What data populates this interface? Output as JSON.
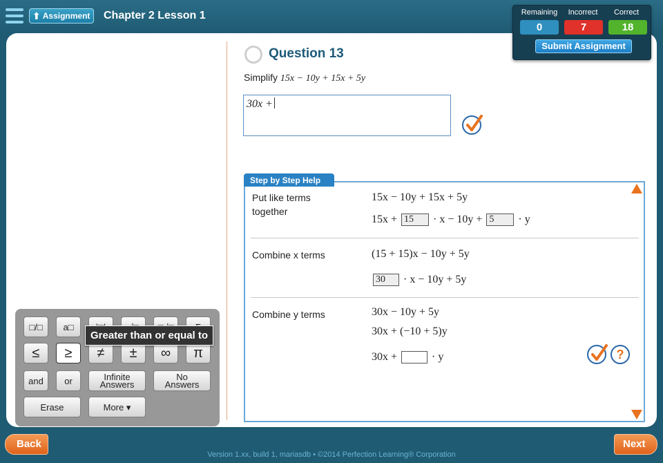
{
  "header": {
    "assignment_label": "Assignment",
    "chapter_title": "Chapter 2 Lesson 1"
  },
  "score": {
    "remaining_label": "Remaining",
    "remaining_value": "0",
    "incorrect_label": "Incorrect",
    "incorrect_value": "7",
    "correct_label": "Correct",
    "correct_value": "18",
    "submit_label": "Submit Assignment",
    "colors": {
      "remaining": "#2f8fbf",
      "incorrect": "#e0312b",
      "correct": "#52b32c"
    }
  },
  "question": {
    "title": "Question 13",
    "prompt_prefix": "Simplify",
    "prompt_expr": "15x − 10y + 15x + 5y",
    "answer_value": "30x +"
  },
  "step_help": {
    "tab_label": "Step by Step Help",
    "steps": [
      {
        "label": "Put like terms together",
        "line1": "15x − 10y + 15x + 5y",
        "line2_a": "15x +",
        "line2_box1": "15",
        "line2_b": "· x − 10y +",
        "line2_box2": "5",
        "line2_c": "· y"
      },
      {
        "label": "Combine x terms",
        "line1": "(15 + 15)x − 10y + 5y",
        "line2_box": "30",
        "line2_b": "· x − 10y + 5y"
      },
      {
        "label": "Combine y terms",
        "line1": "30x − 10y + 5y",
        "line2": "30x + (−10 + 5)y",
        "line3_a": "30x +",
        "line3_box": "",
        "line3_b": "· y"
      }
    ]
  },
  "keypad": {
    "row1": [
      "□/□",
      "a□",
      "|□|",
      "√□",
      "□√□",
      "Σ"
    ],
    "row2": [
      "≤",
      "≥",
      "≠",
      "±",
      "∞",
      "π"
    ],
    "row3": [
      "and",
      "or",
      "Infinite Answers",
      "No Answers"
    ],
    "row4": [
      "Erase",
      "More ▾"
    ],
    "tooltip": "Greater than or equal to"
  },
  "nav": {
    "back_label": "Back",
    "next_label": "Next"
  },
  "footer": "Version 1.xx, build 1, mariasdb • ©2014 Perfection Learning® Corporation",
  "icons": [
    "menu-icon",
    "up-arrow-icon",
    "checkmark-icon",
    "help-icon",
    "scroll-up-icon",
    "scroll-down-icon"
  ]
}
